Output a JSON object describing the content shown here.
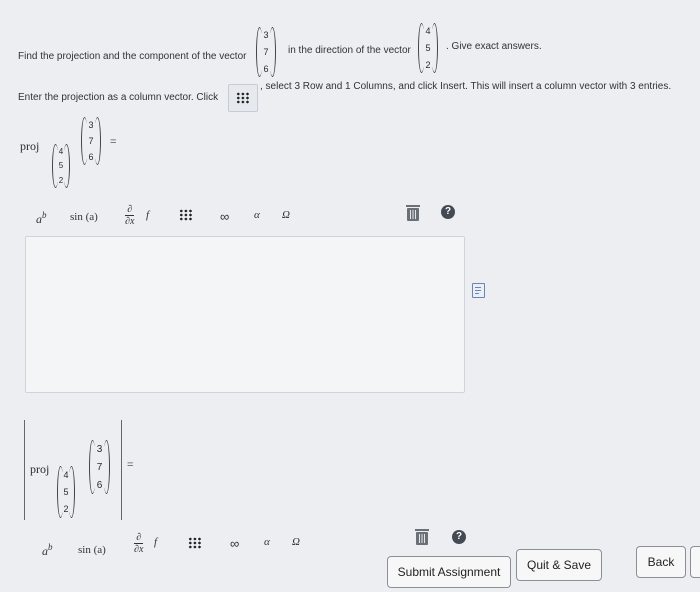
{
  "question": {
    "line1_prefix": "Find the projection and the component of the vector",
    "line1_middle": "in the direction of the vector",
    "line1_suffix": ". Give exact answers.",
    "vector_u": [
      "3",
      "7",
      "6"
    ],
    "vector_v": [
      "4",
      "5",
      "2"
    ],
    "line2_prefix": "Enter the projection as a column vector. Click",
    "line2_suffix": ", select 3 Row and 1 Columns, and click Insert. This will insert a column vector with 3 entries."
  },
  "expression1": {
    "op": "proj",
    "sub_vector": [
      "4",
      "5",
      "2"
    ],
    "vector": [
      "3",
      "7",
      "6"
    ],
    "equals": "="
  },
  "toolbar": {
    "power_label": "a",
    "power_sup": "b",
    "sin_label": "sin (a)",
    "partial_top": "∂",
    "partial_bottom": "∂x",
    "partial_f": "f",
    "infinity": "∞",
    "alpha": "α",
    "omega": "Ω",
    "help": "?"
  },
  "expression2": {
    "op": "proj",
    "sub_vector": [
      "4",
      "5",
      "2"
    ],
    "vector": [
      "3",
      "7",
      "6"
    ],
    "equals": "="
  },
  "buttons": {
    "submit": "Submit Assignment",
    "quit_save": "Quit & Save",
    "back": "Back"
  }
}
